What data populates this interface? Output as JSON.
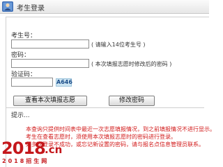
{
  "window": {
    "title": "考生登录"
  },
  "form": {
    "candidate_id_label": "考生号：",
    "candidate_id_value": "",
    "candidate_id_hint": "( 请输入14位考生号 )",
    "password_label": "密码：",
    "password_value": "",
    "password_hint": "( 本次填报志愿时修改后的密码 )",
    "captcha_label": "验证码：",
    "captcha_value": "",
    "captcha_image_text": "A646",
    "view_button": "查看本次填报志愿",
    "change_password_button": "修改密码"
  },
  "notice": {
    "heading": "提示...",
    "lines": [
      "本查询只提供时间表中最近一次志愿填报情况，到之前填报情况不进行显示。",
      "考生在查看志愿时，须使用本次填报志愿时的密码进行登录。",
      "如多次登录不成功，或忘记新设置的密码，请与报名点信息管理员联系。"
    ]
  },
  "watermark": {
    "main": "2018",
    "tld": ".cn",
    "subtitle": "2018招生网"
  },
  "colors": {
    "notice_text": "#d21a1a",
    "captcha_bg": "#cde5f2",
    "watermark": "#c4171b"
  }
}
